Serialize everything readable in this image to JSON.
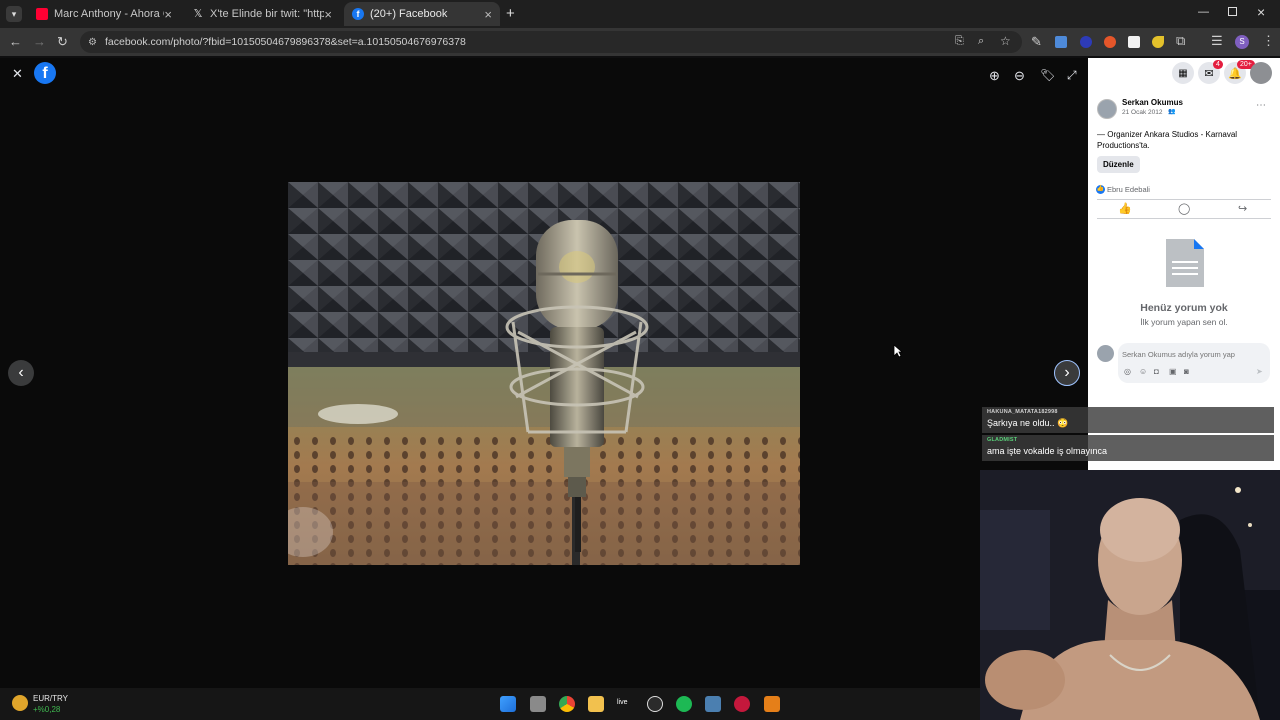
{
  "browser": {
    "tabs": [
      {
        "title": "Marc Anthony - Ahora Quien (P",
        "favicon": "youtube-icon"
      },
      {
        "title": "X'te Elinde bir twit: \"https://t.co",
        "favicon": "x-icon"
      },
      {
        "title": "(20+) Facebook",
        "favicon": "facebook-icon",
        "active": true
      }
    ],
    "new_tab": "+",
    "url": "facebook.com/photo/?fbid=10150504679896378&set=a.10150504676976378"
  },
  "viewer": {
    "close_glyph": "✕",
    "prev_glyph": "‹",
    "next_glyph": "›",
    "zoom_in": "zoom-in-icon",
    "zoom_out": "zoom-out-icon",
    "tag": "tag-icon",
    "fullscreen": "fullscreen-icon"
  },
  "panel": {
    "notifications": {
      "messenger_badge": "4",
      "bell_badge": "20+"
    },
    "author": "Serkan Okumus",
    "date": "21 Ocak 2012",
    "location_text": "— Organizer Ankara Studios - Karnaval Productions'ta.",
    "edit_button": "Düzenle",
    "reaction_name": "Ebru Edebali",
    "no_comments_title": "Henüz yorum yok",
    "no_comments_sub": "İlk yorum yapan sen ol.",
    "comment_placeholder": "Serkan Okumus adıyla yorum yap"
  },
  "chat": [
    {
      "user": "HAKUNA_MATATA182998",
      "message": "Şarkıya ne oldu.. 😳"
    },
    {
      "user": "GLADMIST",
      "message": "ama işte vokalde iş olmayınca"
    }
  ],
  "taskbar": {
    "ticker_name": "EUR/TRY",
    "ticker_change": "+%0,28",
    "live_label": "live"
  },
  "colors": {
    "facebook_blue": "#1877f2",
    "tab_bar": "#1f1f1f",
    "toolbar": "#353535",
    "viewer_bg": "#0a0a0a",
    "ticker_green": "#3fb950"
  }
}
